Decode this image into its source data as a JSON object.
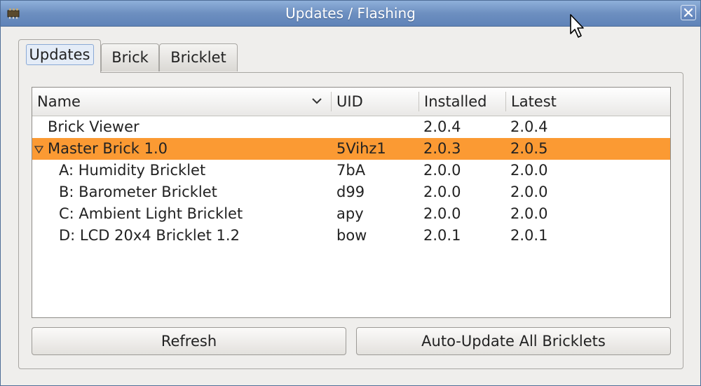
{
  "window": {
    "title": "Updates / Flashing"
  },
  "tabs": [
    {
      "label": "Updates",
      "active": true
    },
    {
      "label": "Brick",
      "active": false
    },
    {
      "label": "Bricklet",
      "active": false
    }
  ],
  "tree": {
    "columns": [
      "Name",
      "UID",
      "Installed",
      "Latest"
    ],
    "rows": [
      {
        "name": "Brick Viewer",
        "uid": "",
        "installed": "2.0.4",
        "latest": "2.0.4",
        "selected": false
      },
      {
        "name": "Master Brick 1.0",
        "uid": "5Vihz1",
        "installed": "2.0.3",
        "latest": "2.0.5",
        "selected": true,
        "expanded": true
      },
      {
        "name": "A: Humidity Bricklet",
        "uid": "7bA",
        "installed": "2.0.0",
        "latest": "2.0.0",
        "selected": false
      },
      {
        "name": "B: Barometer Bricklet",
        "uid": "d99",
        "installed": "2.0.0",
        "latest": "2.0.0",
        "selected": false
      },
      {
        "name": "C: Ambient Light Bricklet",
        "uid": "apy",
        "installed": "2.0.0",
        "latest": "2.0.0",
        "selected": false
      },
      {
        "name": "D: LCD 20x4 Bricklet 1.2",
        "uid": "bow",
        "installed": "2.0.1",
        "latest": "2.0.1",
        "selected": false
      }
    ]
  },
  "buttons": {
    "refresh": "Refresh",
    "auto_update": "Auto-Update All Bricklets"
  },
  "colors": {
    "selection": "#fb9a33",
    "titlebar": "#6d8fc0"
  },
  "icons": {
    "app": "brick-app-icon",
    "close": "close-icon",
    "sort": "chevron-down-icon",
    "expander": "tree-expanded-triangle-icon",
    "cursor": "mouse-pointer-icon"
  }
}
